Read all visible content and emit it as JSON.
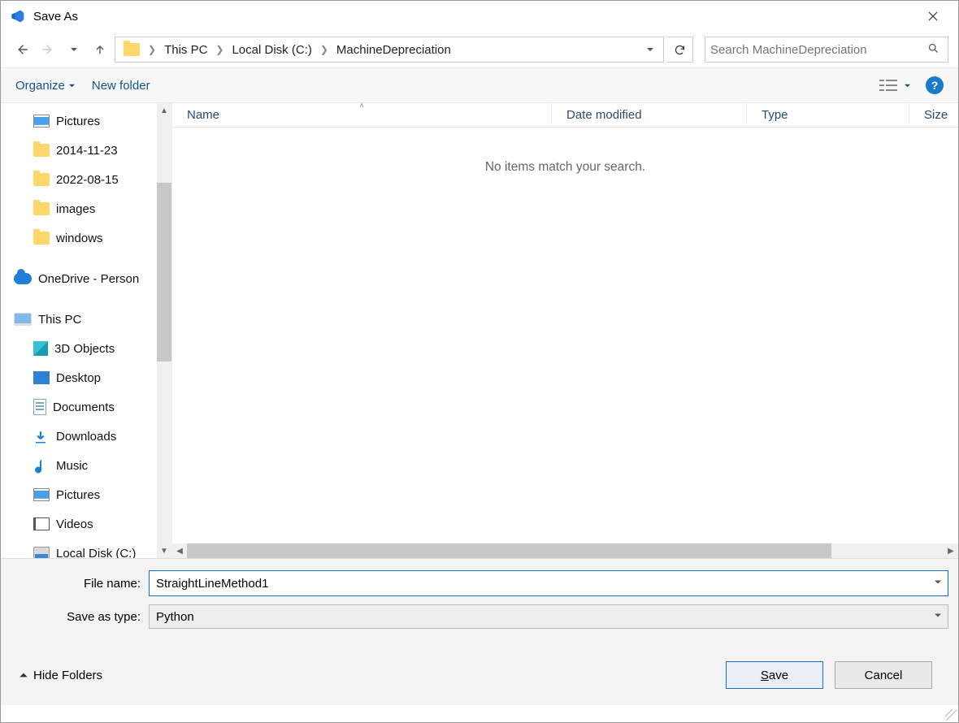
{
  "title": "Save As",
  "breadcrumb": {
    "segments": [
      "This PC",
      "Local Disk (C:)",
      "MachineDepreciation"
    ]
  },
  "search": {
    "placeholder": "Search MachineDepreciation"
  },
  "toolbar": {
    "organize": "Organize",
    "new_folder": "New folder"
  },
  "columns": {
    "name": "Name",
    "date": "Date modified",
    "type": "Type",
    "size": "Size"
  },
  "empty_message": "No items match your search.",
  "tree": {
    "items": [
      {
        "label": "Pictures",
        "icon": "pic",
        "level": 1,
        "pinned": true
      },
      {
        "label": "2014-11-23",
        "icon": "folder",
        "level": 1
      },
      {
        "label": "2022-08-15",
        "icon": "folder",
        "level": 1
      },
      {
        "label": "images",
        "icon": "folder",
        "level": 1
      },
      {
        "label": "windows",
        "icon": "folder",
        "level": 1
      },
      {
        "label": "OneDrive - Person",
        "icon": "cloud",
        "level": 0,
        "spaced": true
      },
      {
        "label": "This PC",
        "icon": "pc",
        "level": 0,
        "spaced": true
      },
      {
        "label": "3D Objects",
        "icon": "cube3d",
        "level": 1
      },
      {
        "label": "Desktop",
        "icon": "desk",
        "level": 1
      },
      {
        "label": "Documents",
        "icon": "doc",
        "level": 1
      },
      {
        "label": "Downloads",
        "icon": "dl",
        "level": 1
      },
      {
        "label": "Music",
        "icon": "music",
        "level": 1
      },
      {
        "label": "Pictures",
        "icon": "pic",
        "level": 1
      },
      {
        "label": "Videos",
        "icon": "vid",
        "level": 1
      },
      {
        "label": "Local Disk (C:)",
        "icon": "disk",
        "level": 1
      }
    ]
  },
  "filename": {
    "label": "File name:",
    "value": "StraightLineMethod1"
  },
  "savetype": {
    "label": "Save as type:",
    "value": "Python"
  },
  "buttons": {
    "save": "Save",
    "cancel": "Cancel",
    "hide_folders": "Hide Folders"
  }
}
